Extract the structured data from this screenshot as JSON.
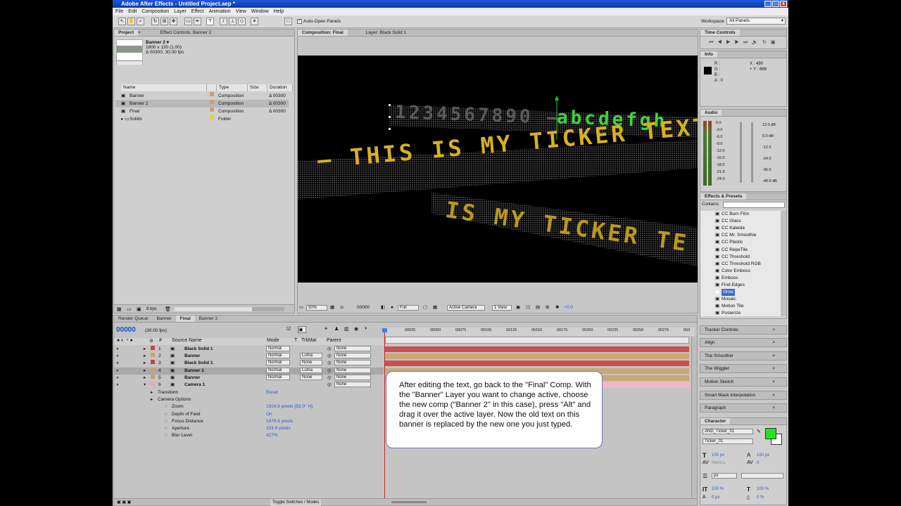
{
  "window": {
    "title": "Adobe After Effects - Untitled Project.aep *"
  },
  "menu": [
    "File",
    "Edit",
    "Composition",
    "Layer",
    "Effect",
    "Animation",
    "View",
    "Window",
    "Help"
  ],
  "toolbar": {
    "auto_open_label": "Auto-Open Panels",
    "workspace_label": "Workspace:",
    "workspace_value": "All Panels"
  },
  "project_panel": {
    "tabs": [
      "Project",
      "Effect Controls: Banner 2"
    ],
    "preview_name": "Banner 2 ▾",
    "preview_dims": "1800 x 130 (1.00)",
    "preview_duration": "Δ 00300, 30.00 fps",
    "columns": [
      "Name",
      "Type",
      "Size",
      "Duration"
    ],
    "items": [
      {
        "name": "Banner",
        "type": "Composition",
        "duration": "Δ 00300",
        "color": "#c8a070"
      },
      {
        "name": "Banner 2",
        "type": "Composition",
        "duration": "Δ 00300",
        "color": "#c8a070"
      },
      {
        "name": "Final",
        "type": "Composition",
        "duration": "Δ 00300",
        "color": "#c8a070"
      },
      {
        "name": "Solids",
        "type": "Folder",
        "duration": "",
        "color": "#e8d040"
      }
    ],
    "bpc": "8 bpc"
  },
  "comp_panel": {
    "tabs": [
      "Composition: Final",
      "Layer: Black Solid 1"
    ],
    "zoom": "50%",
    "timecode": "00000",
    "resolution": "Full",
    "camera": "Active Camera",
    "view": "1 View",
    "exposure": "+0.0",
    "led_digits": "1234567890 —",
    "led_alpha": "abcdefgh",
    "led_line1": "— THIS IS MY TICKER TEXT —",
    "led_line2": "IS MY TICKER TE"
  },
  "timeline": {
    "tabs": [
      "Render Queue",
      "Banner",
      "Final",
      "Banner 2"
    ],
    "timecode": "00000",
    "fps": "(30.00 fps)",
    "ruler": [
      "00025",
      "00050",
      "00075",
      "00100",
      "00125",
      "00150",
      "00175",
      "00200",
      "00225",
      "00250",
      "00275",
      "003"
    ],
    "col_headers": {
      "num": "#",
      "source": "Source Name",
      "mode": "Mode",
      "t": "T",
      "trkmat": "TrkMat",
      "parent": "Parent"
    },
    "layers": [
      {
        "num": "1",
        "name": "Black Solid 1",
        "mode": "Normal",
        "trkmat": "",
        "parent": "None",
        "label": "#c04848",
        "bar": "#c85050"
      },
      {
        "num": "2",
        "name": "Banner",
        "mode": "Normal",
        "trkmat": "Luma",
        "parent": "None",
        "label": "#c8a070",
        "bar": "#c8a878"
      },
      {
        "num": "3",
        "name": "Black Solid 1",
        "mode": "Normal",
        "trkmat": "None",
        "parent": "None",
        "label": "#c04848",
        "bar": "#c85050"
      },
      {
        "num": "4",
        "name": "Banner 2",
        "mode": "Normal",
        "trkmat": "Luma",
        "parent": "None",
        "label": "#c8a070",
        "bar": "#c8a878"
      },
      {
        "num": "5",
        "name": "Banner",
        "mode": "Normal",
        "trkmat": "None",
        "parent": "None",
        "label": "#c8a070",
        "bar": "#c8a878"
      },
      {
        "num": "6",
        "name": "Camera 1",
        "mode": "",
        "trkmat": "",
        "parent": "None",
        "label": "#e8a8b8",
        "bar": "#f0b8c8"
      }
    ],
    "props": [
      {
        "name": "Transform",
        "value": "Reset",
        "indent": 1
      },
      {
        "name": "Camera Options",
        "value": "",
        "indent": 1
      },
      {
        "name": "Zoom",
        "value": "1924.6 pixels (53.0° H)",
        "indent": 2
      },
      {
        "name": "Depth of Field",
        "value": "On",
        "indent": 2
      },
      {
        "name": "Focus Distance",
        "value": "1479.6 pixels",
        "indent": 2
      },
      {
        "name": "Aperture",
        "value": "103.8 pixels",
        "indent": 2
      },
      {
        "name": "Blur Level",
        "value": "427%",
        "indent": 2
      }
    ],
    "toggle_label": "Toggle Switches / Modes"
  },
  "callout": "After editing the text, go back to the \"Final\" Comp. With the \"Banner\" Layer you want to change active, choose the new comp (\"Banner 2\" in this case), press \"Alt\" and drag it over the active layer. Now the old text on this banner is replaced by the new one you just typed.",
  "right": {
    "time_controls": "Time Controls",
    "info": {
      "title": "Info",
      "r": "R :",
      "g": "G :",
      "b": "B :",
      "a": "A : 0",
      "x": "X : 490",
      "y": "+ Y : 686"
    },
    "audio": {
      "title": "Audio",
      "left": [
        "0.0",
        "-3.0",
        "-6.0",
        "-9.0",
        "-12.0",
        "-15.0",
        "-18.0",
        "-21.0",
        "-24.0"
      ],
      "right": [
        "12.0 dB",
        "0.0 dB",
        "-12.0",
        "-24.0",
        "-36.0",
        "-48.0 dB"
      ]
    },
    "effects": {
      "title": "Effects & Presets",
      "contains": "Contains:",
      "items": [
        "CC Burn Film",
        "CC Glass",
        "CC Kaleida",
        "CC Mr. Smoothie",
        "CC Plastic",
        "CC RepeTile",
        "CC Threshold",
        "CC Threshold RGB",
        "Color Emboss",
        "Emboss",
        "Find Edges",
        "Glow",
        "Mosaic",
        "Motion Tile",
        "Posterize"
      ],
      "selected": "Glow"
    },
    "collapsed": [
      "Tracker Controls",
      "Align",
      "The Smoother",
      "The Wiggler",
      "Motion Sketch",
      "Smart Mask Interpolation",
      "Paragraph"
    ],
    "character": {
      "title": "Character",
      "font": "AND_Ticker_01",
      "style": "Ticker_01",
      "size": "100 px",
      "leading": "150 px",
      "tracking": "0",
      "kern": "Metrics",
      "units": "px",
      "vscale": "100 %",
      "hscale": "100 %",
      "baseline": "0 px",
      "tsume": "0 %",
      "fill": "#22e622"
    }
  }
}
